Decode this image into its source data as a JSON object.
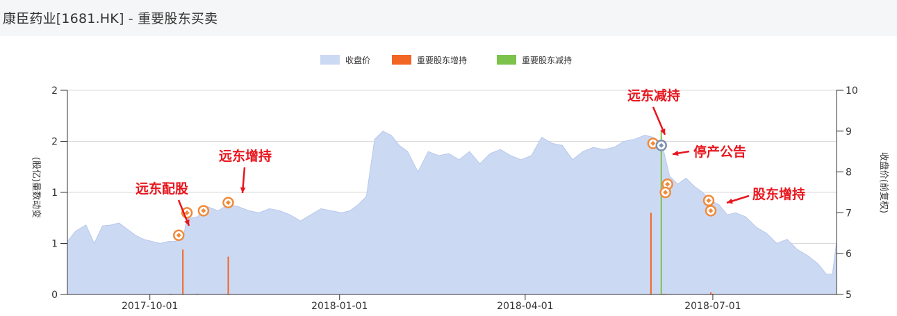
{
  "page": {
    "title": "康臣药业[1681.HK] - 重要股东买卖"
  },
  "colors": {
    "area": "#ccd9f3",
    "area_line": "#b7c8ec",
    "increase": "#f26522",
    "decrease": "#7dc24b",
    "marker": "#f08a3c",
    "marker_decrease": "#7a8fb0",
    "annotation": "#e8161e",
    "grid": "#d8d8d8"
  },
  "legend": {
    "items": [
      {
        "label": "收盘价",
        "color": "#ccd9f3"
      },
      {
        "label": "重要股东增持",
        "color": "#f26522"
      },
      {
        "label": "重要股东减持",
        "color": "#7dc24b"
      }
    ]
  },
  "chart_data": {
    "type": "area",
    "title": "",
    "y_left": {
      "label": "(股亿)量数动变",
      "ticks": [
        "0",
        "1",
        "1",
        "2",
        "2"
      ],
      "tick_values": [
        0,
        0.5,
        1,
        1.5,
        2
      ],
      "ylim": [
        0,
        2
      ]
    },
    "y_right": {
      "label": "收盘价(前复权)",
      "ticks": [
        "5",
        "6",
        "7",
        "8",
        "9",
        "10"
      ],
      "tick_values": [
        5,
        6,
        7,
        8,
        9,
        10
      ],
      "ylim": [
        5,
        10
      ]
    },
    "x_axis": {
      "xlim": [
        "2017-08-22",
        "2018-08-30"
      ],
      "ticks": [
        "2017-10-01",
        "2018-01-01",
        "2018-04-01",
        "2018-07-01"
      ]
    },
    "series": [
      {
        "name": "收盘价",
        "x": [
          "2017-08-22",
          "2017-08-26",
          "2017-08-31",
          "2017-09-04",
          "2017-09-08",
          "2017-09-12",
          "2017-09-16",
          "2017-09-20",
          "2017-09-24",
          "2017-09-28",
          "2017-10-02",
          "2017-10-06",
          "2017-10-10",
          "2017-10-13",
          "2017-10-17",
          "2017-10-19",
          "2017-10-24",
          "2017-10-29",
          "2017-11-03",
          "2017-11-08",
          "2017-11-13",
          "2017-11-18",
          "2017-11-23",
          "2017-11-28",
          "2017-12-03",
          "2017-12-08",
          "2017-12-13",
          "2017-12-18",
          "2017-12-23",
          "2017-12-28",
          "2018-01-02",
          "2018-01-06",
          "2018-01-10",
          "2018-01-14",
          "2018-01-18",
          "2018-01-22",
          "2018-01-26",
          "2018-01-30",
          "2018-02-03",
          "2018-02-08",
          "2018-02-13",
          "2018-02-18",
          "2018-02-23",
          "2018-02-28",
          "2018-03-05",
          "2018-03-10",
          "2018-03-15",
          "2018-03-20",
          "2018-03-25",
          "2018-03-30",
          "2018-04-04",
          "2018-04-09",
          "2018-04-14",
          "2018-04-19",
          "2018-04-24",
          "2018-04-29",
          "2018-05-04",
          "2018-05-09",
          "2018-05-14",
          "2018-05-19",
          "2018-05-24",
          "2018-05-29",
          "2018-06-02",
          "2018-06-05",
          "2018-06-07",
          "2018-06-10",
          "2018-06-14",
          "2018-06-18",
          "2018-06-22",
          "2018-06-26",
          "2018-06-30",
          "2018-07-04",
          "2018-07-08",
          "2018-07-12",
          "2018-07-17",
          "2018-07-22",
          "2018-07-27",
          "2018-08-01",
          "2018-08-06",
          "2018-08-11",
          "2018-08-16",
          "2018-08-21",
          "2018-08-25",
          "2018-08-28",
          "2018-08-30"
        ],
        "values": [
          6.3,
          6.55,
          6.7,
          6.25,
          6.68,
          6.7,
          6.75,
          6.6,
          6.45,
          6.35,
          6.3,
          6.25,
          6.3,
          6.3,
          6.35,
          6.85,
          6.9,
          7.15,
          7.05,
          7.2,
          7.15,
          7.05,
          7.0,
          7.1,
          7.05,
          6.95,
          6.8,
          6.95,
          7.1,
          7.05,
          7.0,
          7.05,
          7.2,
          7.4,
          8.8,
          9.0,
          8.9,
          8.65,
          8.5,
          8.0,
          8.5,
          8.4,
          8.45,
          8.3,
          8.5,
          8.2,
          8.45,
          8.55,
          8.4,
          8.3,
          8.4,
          8.85,
          8.7,
          8.65,
          8.3,
          8.5,
          8.6,
          8.55,
          8.6,
          8.75,
          8.8,
          8.9,
          8.85,
          8.75,
          8.55,
          7.9,
          7.7,
          7.85,
          7.65,
          7.5,
          7.3,
          7.2,
          6.95,
          7.0,
          6.9,
          6.65,
          6.5,
          6.25,
          6.35,
          6.1,
          5.95,
          5.75,
          5.5,
          5.5,
          6.3
        ]
      },
      {
        "name": "重要股东增持",
        "type": "bar",
        "x": [
          "2017-10-11",
          "2017-10-17",
          "2017-10-24",
          "2017-11-08",
          "2018-06-01",
          "2018-06-07",
          "2018-06-08",
          "2018-06-30",
          "2018-07-01"
        ],
        "values": [
          0.007,
          0.44,
          0.007,
          0.37,
          0.8,
          0.007,
          0.007,
          0.02,
          0.007
        ]
      },
      {
        "name": "重要股东减持",
        "type": "bar",
        "x": [
          "2018-06-06"
        ],
        "values": [
          1.6
        ]
      }
    ],
    "markers": [
      {
        "x": "2017-10-15",
        "price": 6.45,
        "kind": "increase"
      },
      {
        "x": "2017-10-19",
        "price": 7.0,
        "kind": "increase"
      },
      {
        "x": "2017-10-27",
        "price": 7.05,
        "kind": "increase"
      },
      {
        "x": "2017-11-08",
        "price": 7.25,
        "kind": "increase"
      },
      {
        "x": "2018-06-02",
        "price": 8.7,
        "kind": "increase"
      },
      {
        "x": "2018-06-06",
        "price": 8.65,
        "kind": "decrease"
      },
      {
        "x": "2018-06-09",
        "price": 7.7,
        "kind": "increase"
      },
      {
        "x": "2018-06-08",
        "price": 7.5,
        "kind": "increase"
      },
      {
        "x": "2018-06-29",
        "price": 7.3,
        "kind": "increase"
      },
      {
        "x": "2018-06-30",
        "price": 7.05,
        "kind": "increase"
      }
    ],
    "annotations": [
      {
        "text": "远东配股"
      },
      {
        "text": "远东增持"
      },
      {
        "text": "远东减持"
      },
      {
        "text": "停产公告"
      },
      {
        "text": "股东增持"
      }
    ]
  }
}
